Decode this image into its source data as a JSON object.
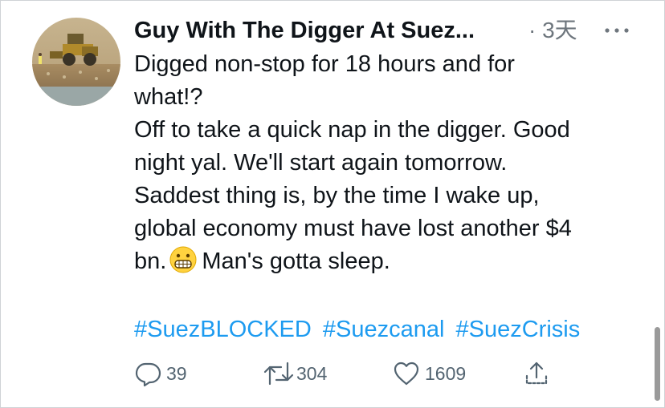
{
  "tweet": {
    "author_name": "Guy With The Digger At Suez...",
    "time": "· 3天",
    "more_icon": "more-horizontal-icon",
    "text_lines": [
      "Digged non-stop for 18 hours and for",
      "what!?",
      "Off to take a quick nap in the digger. Good",
      "night yal. We'll start again tomorrow.",
      "Saddest thing is, by the time I wake up,",
      "global economy must have lost another $4"
    ],
    "last_line_before_emoji": "bn.",
    "emoji": "grimacing-face-emoji",
    "last_line_after_emoji": "Man's gotta sleep.",
    "hashtags": [
      "#SuezBLOCKED",
      "#Suezcanal",
      "#SuezCrisis"
    ],
    "actions": {
      "reply": {
        "icon": "reply-icon",
        "count": "39"
      },
      "retweet": {
        "icon": "retweet-icon",
        "count": "304"
      },
      "like": {
        "icon": "heart-icon",
        "count": "1609"
      },
      "share": {
        "icon": "share-icon"
      }
    }
  },
  "colors": {
    "text": "#0f1419",
    "secondary": "#6e767d",
    "link": "#1d9bf0",
    "action": "#536471"
  }
}
